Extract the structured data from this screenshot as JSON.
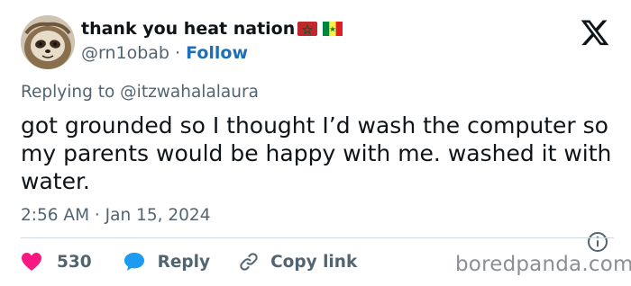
{
  "author": {
    "display_name": "thank you heat nation",
    "handle": "@rn1obab",
    "separator": "·",
    "follow_label": "Follow",
    "flags": [
      "morocco-flag-icon",
      "senegal-flag-icon"
    ]
  },
  "platform_logo": "x-logo-icon",
  "replying_to": "Replying to @itzwahalalaura",
  "tweet_text": "got grounded so I thought I’d wash the computer so my parents would be happy with me. washed it with water.",
  "timestamp": "2:56 AM · Jan 15, 2024",
  "actions": {
    "like_count": "530",
    "reply_label": "Reply",
    "copy_link_label": "Copy link"
  },
  "watermark": "boredpanda.com",
  "colors": {
    "like_red": "#f91880",
    "reply_blue": "#1d9bf0",
    "follow_blue": "#1d70b8",
    "secondary_text": "#536471"
  }
}
